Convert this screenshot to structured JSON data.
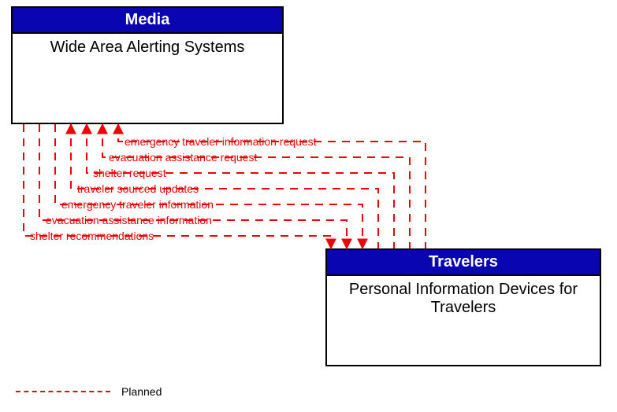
{
  "boxes": {
    "source": {
      "header": "Media",
      "title": "Wide Area Alerting Systems"
    },
    "target": {
      "header": "Travelers",
      "title": "Personal Information Devices for Travelers"
    }
  },
  "flows": [
    {
      "label": "emergency traveler information request",
      "direction": "to_source"
    },
    {
      "label": "evacuation assistance request",
      "direction": "to_source"
    },
    {
      "label": "shelter request",
      "direction": "to_source"
    },
    {
      "label": "traveler sourced updates",
      "direction": "to_source"
    },
    {
      "label": "emergency traveler information",
      "direction": "to_target"
    },
    {
      "label": "evacuation assistance information",
      "direction": "to_target"
    },
    {
      "label": "shelter recommendations",
      "direction": "to_target"
    }
  ],
  "legend": {
    "planned": "Planned"
  },
  "chart_data": {
    "type": "diagram",
    "title": "Architecture flow diagram",
    "nodes": [
      {
        "id": "wide-area-alerting-systems",
        "group": "Media",
        "label": "Wide Area Alerting Systems"
      },
      {
        "id": "personal-info-devices",
        "group": "Travelers",
        "label": "Personal Information Devices for Travelers"
      }
    ],
    "edges": [
      {
        "from": "personal-info-devices",
        "to": "wide-area-alerting-systems",
        "label": "emergency traveler information request",
        "status": "Planned"
      },
      {
        "from": "personal-info-devices",
        "to": "wide-area-alerting-systems",
        "label": "evacuation assistance request",
        "status": "Planned"
      },
      {
        "from": "personal-info-devices",
        "to": "wide-area-alerting-systems",
        "label": "shelter request",
        "status": "Planned"
      },
      {
        "from": "personal-info-devices",
        "to": "wide-area-alerting-systems",
        "label": "traveler sourced updates",
        "status": "Planned"
      },
      {
        "from": "wide-area-alerting-systems",
        "to": "personal-info-devices",
        "label": "emergency traveler information",
        "status": "Planned"
      },
      {
        "from": "wide-area-alerting-systems",
        "to": "personal-info-devices",
        "label": "evacuation assistance information",
        "status": "Planned"
      },
      {
        "from": "wide-area-alerting-systems",
        "to": "personal-info-devices",
        "label": "shelter recommendations",
        "status": "Planned"
      }
    ],
    "legend": [
      {
        "style": "dashed-red",
        "meaning": "Planned"
      }
    ]
  }
}
